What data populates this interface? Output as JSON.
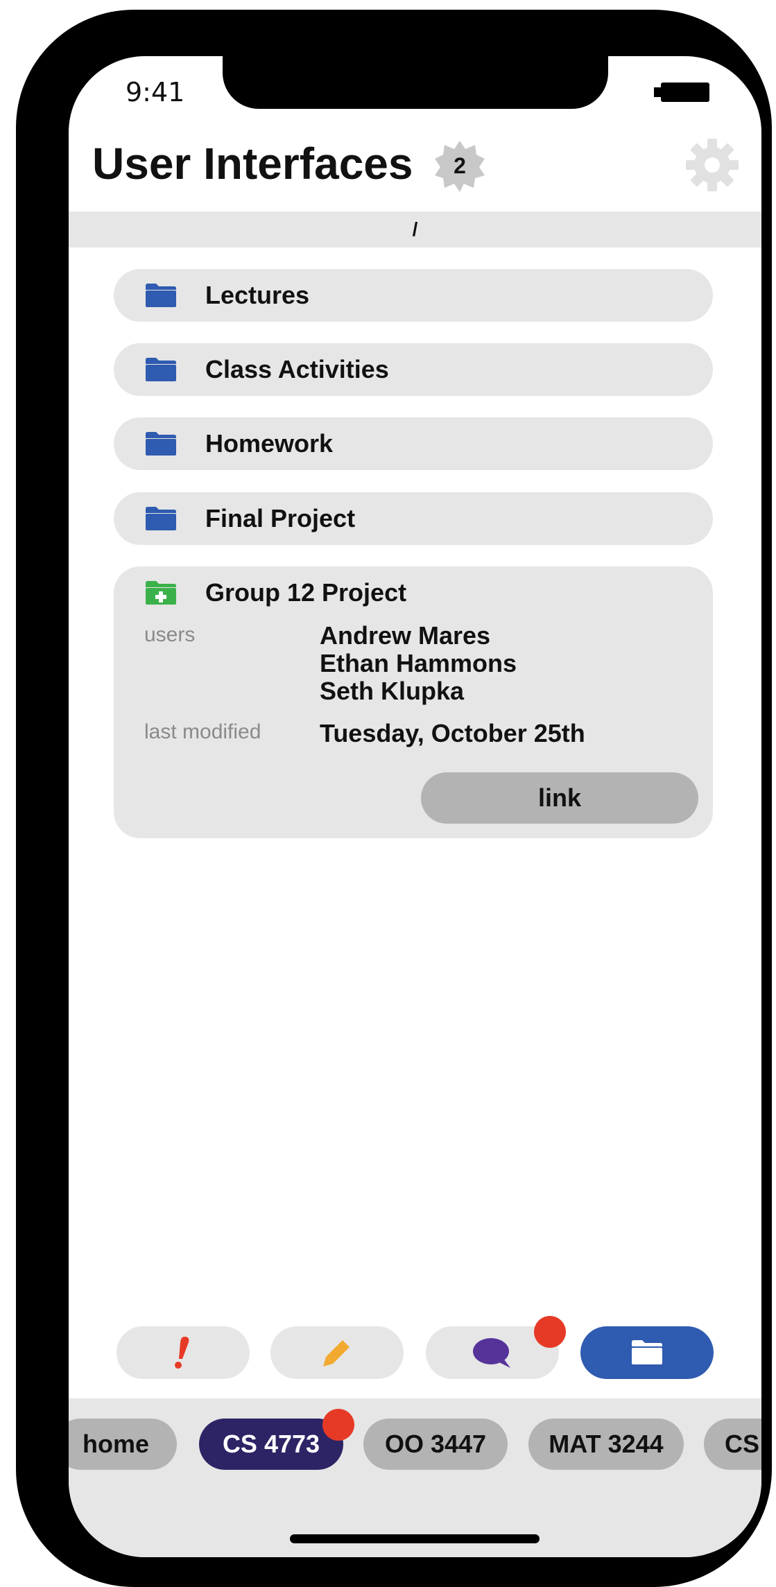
{
  "status_bar": {
    "time": "9:41"
  },
  "header": {
    "title": "User Interfaces",
    "badge_count": "2"
  },
  "path": "/",
  "folders": [
    {
      "label": "Lectures"
    },
    {
      "label": "Class Activities"
    },
    {
      "label": "Homework"
    },
    {
      "label": "Final Project"
    }
  ],
  "group": {
    "title": "Group 12 Project",
    "users_label": "users",
    "users": [
      "Andrew Mares",
      "Ethan Hammons",
      "Seth Klupka"
    ],
    "modified_label": "last modified",
    "modified_value": "Tuesday, October 25th",
    "link_label": "link"
  },
  "toolbar": {
    "buttons": [
      {
        "icon": "exclamation-icon",
        "color": "#e63a26"
      },
      {
        "icon": "pencil-icon",
        "color": "#f2a930"
      },
      {
        "icon": "chat-bubble-icon",
        "color": "#553399"
      },
      {
        "icon": "folder-icon",
        "color": "#ffffff"
      }
    ]
  },
  "courses": [
    {
      "label": "home"
    },
    {
      "label": "CS 4773"
    },
    {
      "label": "OO 3447"
    },
    {
      "label": "MAT 3244"
    },
    {
      "label": "CS"
    }
  ],
  "colors": {
    "folder": "#2f5bb0",
    "group_folder": "#3bb14a",
    "notification": "#e63a26",
    "active_course": "#2d2466",
    "active_tool": "#2f5bb0"
  }
}
